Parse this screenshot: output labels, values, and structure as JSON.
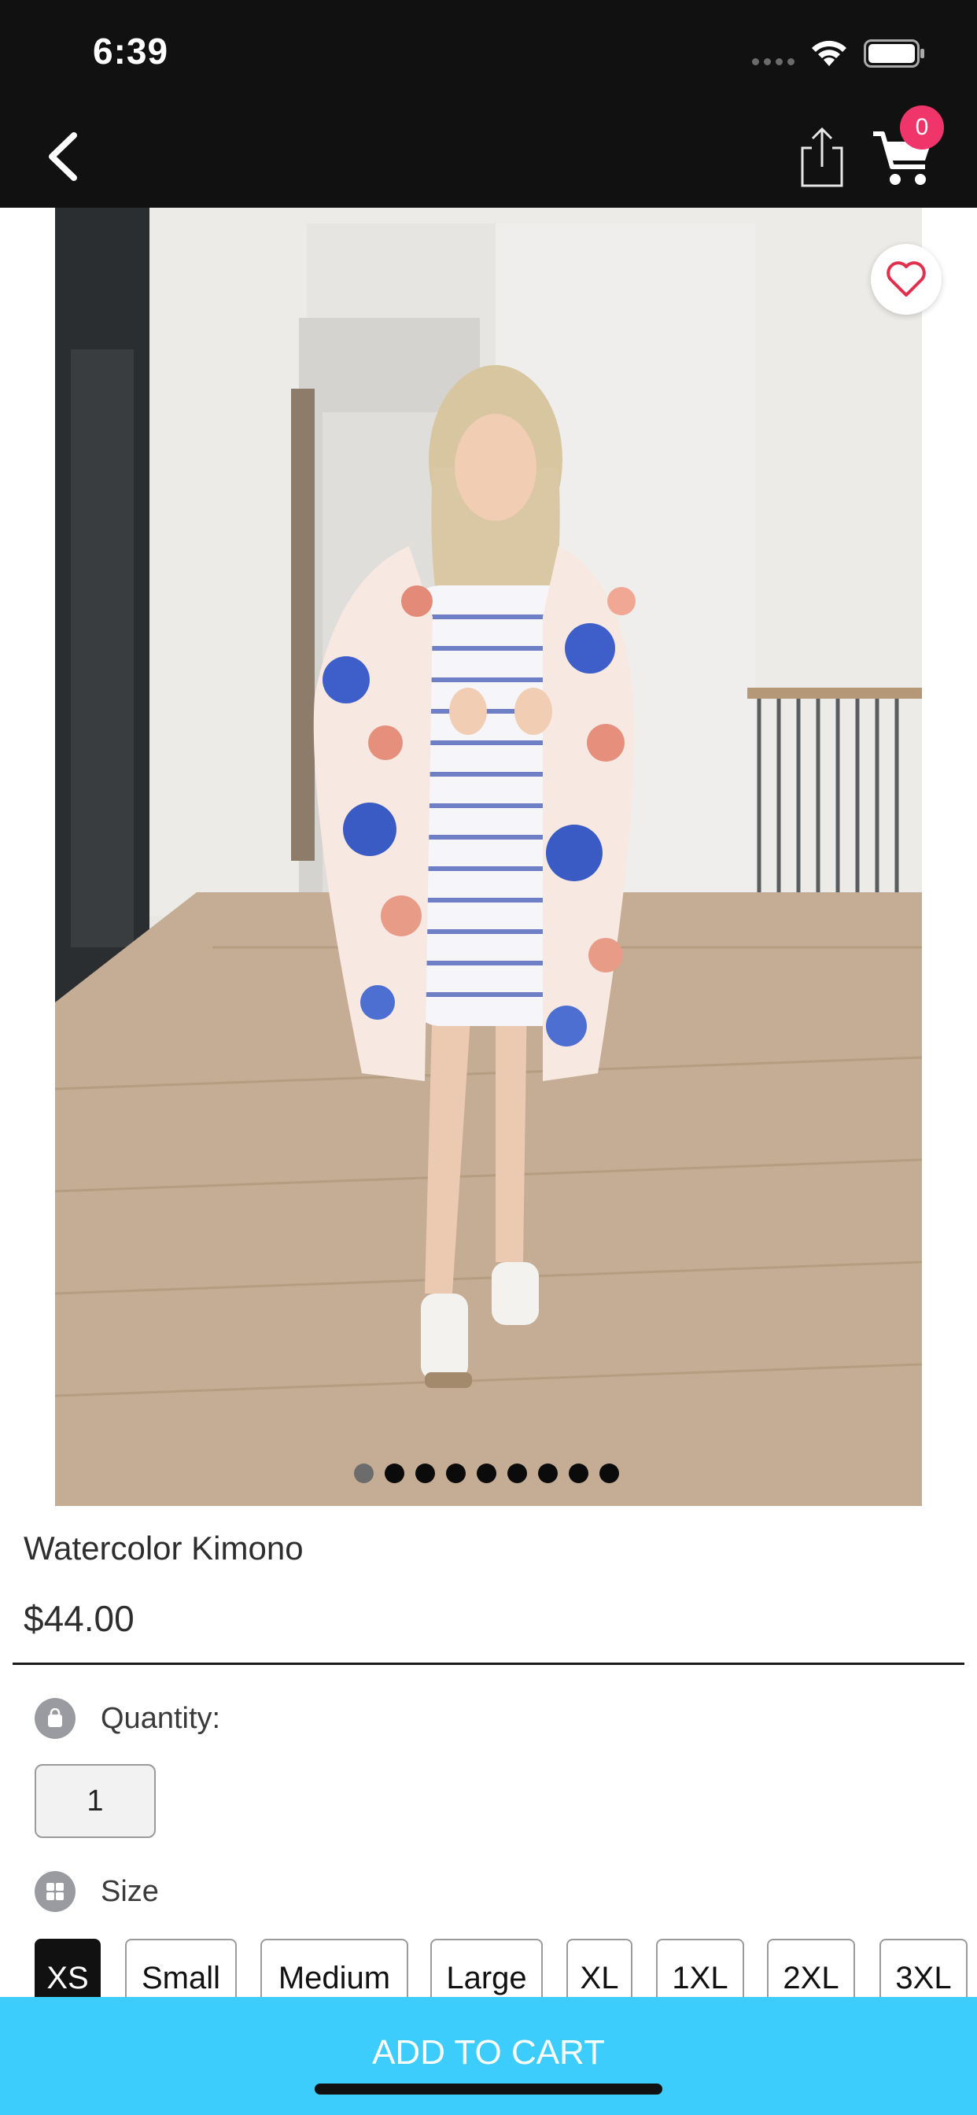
{
  "status_bar": {
    "time": "6:39"
  },
  "nav": {
    "cart_count": "0"
  },
  "product": {
    "title": "Watercolor Kimono",
    "price": "$44.00",
    "photo_count": 9,
    "active_photo_index": 0
  },
  "options": {
    "quantity_label": "Quantity:",
    "quantity_value": "1",
    "size_label": "Size",
    "sizes": [
      "XS",
      "Small",
      "Medium",
      "Large",
      "XL",
      "1XL",
      "2XL",
      "3XL"
    ],
    "selected_size": "XS"
  },
  "cta": {
    "add_to_cart": "ADD TO CART"
  },
  "colors": {
    "accent": "#3ccdfc",
    "badge": "#f0356b",
    "header": "#111111"
  },
  "icons": [
    "back-icon",
    "share-icon",
    "cart-icon",
    "heart-icon",
    "bag-icon",
    "grid-icon",
    "wifi-icon",
    "battery-icon"
  ]
}
